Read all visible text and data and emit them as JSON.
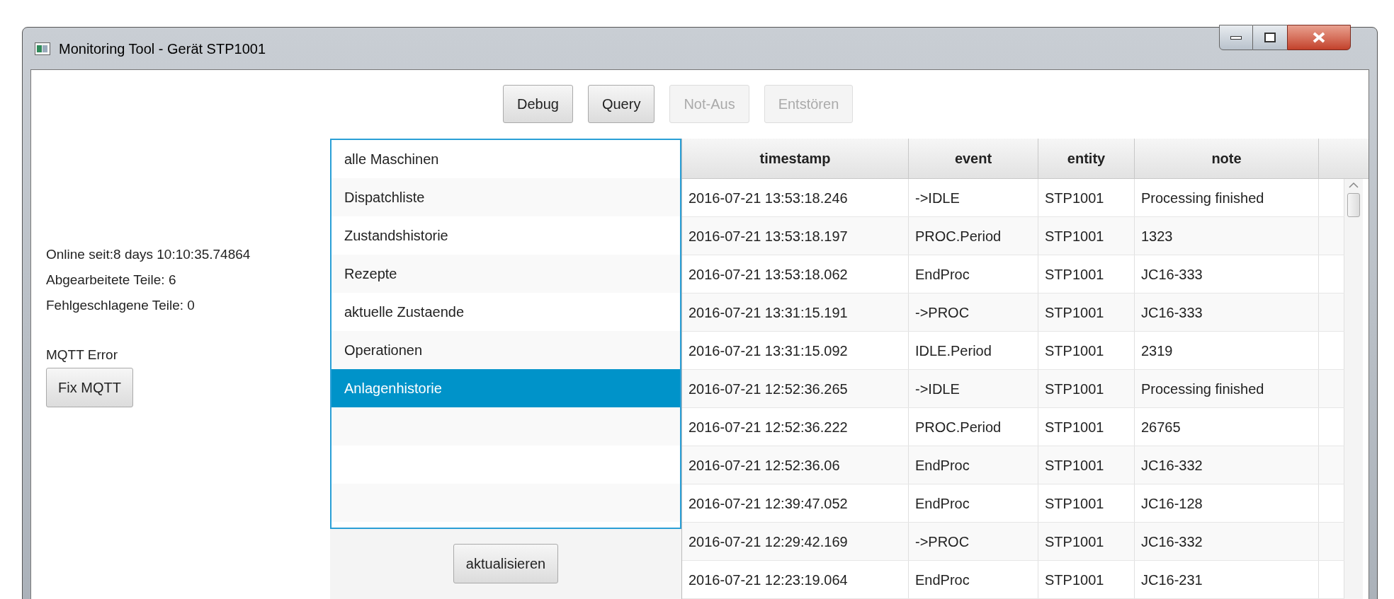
{
  "window": {
    "title": "Monitoring Tool - Gerät STP1001"
  },
  "toolbar": [
    {
      "label": "Debug",
      "disabled": false
    },
    {
      "label": "Query",
      "disabled": false
    },
    {
      "label": "Not-Aus",
      "disabled": true
    },
    {
      "label": "Entstören",
      "disabled": true
    }
  ],
  "status": [
    "Online seit:8 days 10:10:35.74864",
    "Abgearbeitete Teile: 6",
    "Fehlgeschlagene Teile: 0"
  ],
  "mqtt": {
    "label": "MQTT Error",
    "button": "Fix MQTT"
  },
  "views": [
    {
      "label": "alle Maschinen",
      "selected": false
    },
    {
      "label": "Dispatchliste",
      "selected": false
    },
    {
      "label": "Zustandshistorie",
      "selected": false
    },
    {
      "label": "Rezepte",
      "selected": false
    },
    {
      "label": "aktuelle Zustaende",
      "selected": false
    },
    {
      "label": "Operationen",
      "selected": false
    },
    {
      "label": "Anlagenhistorie",
      "selected": true
    }
  ],
  "refresh_button": "aktualisieren",
  "table": {
    "columns": [
      "timestamp",
      "event",
      "entity",
      "note"
    ],
    "rows": [
      [
        "2016-07-21 13:53:18.246",
        "->IDLE",
        "STP1001",
        "Processing finished"
      ],
      [
        "2016-07-21 13:53:18.197",
        "PROC.Period",
        "STP1001",
        "1323"
      ],
      [
        "2016-07-21 13:53:18.062",
        "EndProc",
        "STP1001",
        "JC16-333"
      ],
      [
        "2016-07-21 13:31:15.191",
        "->PROC",
        "STP1001",
        "JC16-333"
      ],
      [
        "2016-07-21 13:31:15.092",
        "IDLE.Period",
        "STP1001",
        "2319"
      ],
      [
        "2016-07-21 12:52:36.265",
        "->IDLE",
        "STP1001",
        "Processing finished"
      ],
      [
        "2016-07-21 12:52:36.222",
        "PROC.Period",
        "STP1001",
        "26765"
      ],
      [
        "2016-07-21 12:52:36.06",
        "EndProc",
        "STP1001",
        "JC16-332"
      ],
      [
        "2016-07-21 12:39:47.052",
        "EndProc",
        "STP1001",
        "JC16-128"
      ],
      [
        "2016-07-21 12:29:42.169",
        "->PROC",
        "STP1001",
        "JC16-332"
      ],
      [
        "2016-07-21 12:23:19.064",
        "EndProc",
        "STP1001",
        "JC16-231"
      ]
    ]
  }
}
